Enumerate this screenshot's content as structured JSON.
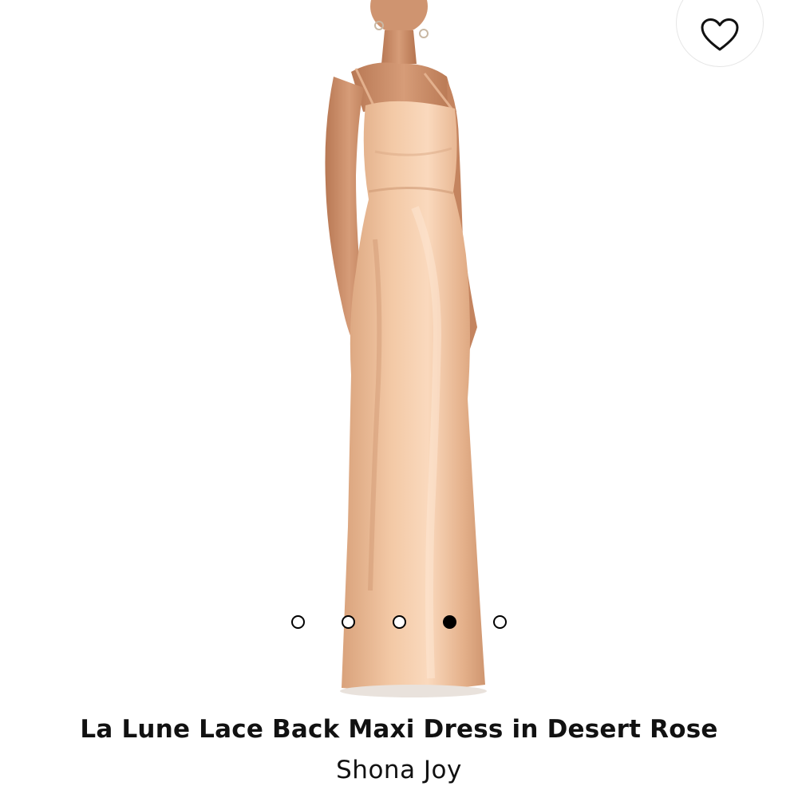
{
  "product": {
    "title": "La Lune Lace Back Maxi Dress in Desert Rose",
    "brand": "Shona Joy",
    "image_alt": "Model wearing a satin slip maxi dress in a peach tone"
  },
  "wishlist": {
    "icon": "heart-outline-icon"
  },
  "carousel": {
    "total_images": 5,
    "active_index": 3
  },
  "colors": {
    "dress": "#e8b791",
    "accent": "#000000"
  }
}
